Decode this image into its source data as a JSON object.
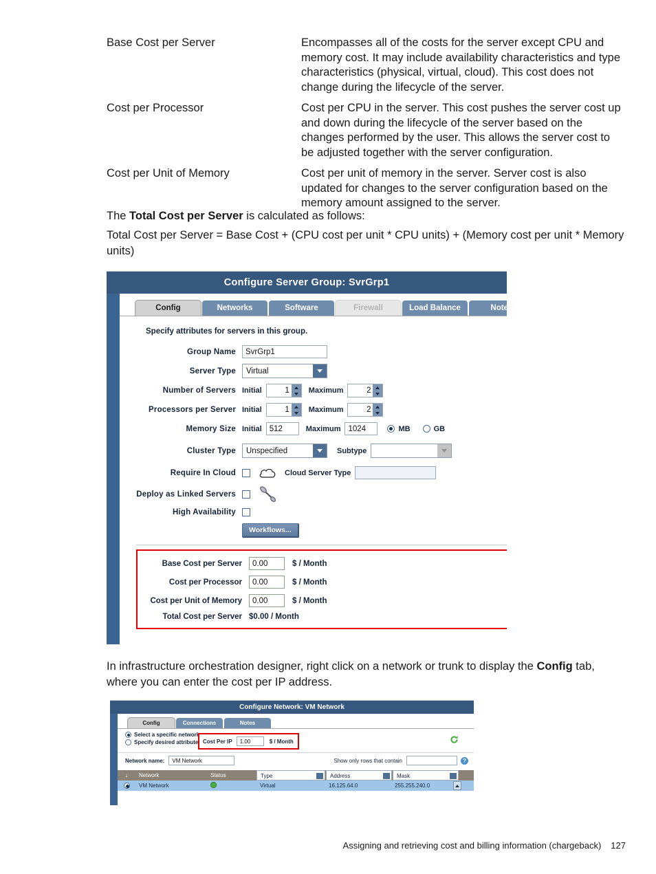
{
  "definitions": [
    {
      "term": "Base Cost per Server",
      "description": "Encompasses all of the costs for the server except CPU and memory cost. It may include availability characteristics and type characteristics (physical, virtual, cloud). This cost does not change during the lifecycle of the server."
    },
    {
      "term": "Cost per Processor",
      "description": "Cost per CPU in the server. This cost pushes the server cost up and down during the lifecycle of the server based on the changes performed by the user. This allows the server cost to be adjusted together with the server configuration."
    },
    {
      "term": "Cost per Unit of Memory",
      "description": "Cost per unit of memory in the server. Server cost is also updated for changes to the server configuration based on the memory amount assigned to the server."
    }
  ],
  "paragraphs": {
    "total_intro_pre": "The ",
    "total_intro_bold": "Total Cost per Server",
    "total_intro_post": " is calculated as follows:",
    "formula": "Total Cost per Server = Base Cost + (CPU cost per unit * CPU units) + (Memory cost per unit * Memory units)",
    "designer_pre": "In infrastructure orchestration designer, right click on a network or trunk to display the ",
    "designer_bold": "Config",
    "designer_post": " tab, where you can enter the cost per IP address."
  },
  "server_dialog": {
    "title": "Configure Server Group: SvrGrp1",
    "tabs": [
      {
        "label": "Config",
        "state": "active"
      },
      {
        "label": "Networks",
        "state": "normal"
      },
      {
        "label": "Software",
        "state": "normal"
      },
      {
        "label": "Firewall",
        "state": "disabled"
      },
      {
        "label": "Load Balance",
        "state": "normal"
      },
      {
        "label": "Notes",
        "state": "normal"
      }
    ],
    "hint": "Specify attributes for servers in this group.",
    "group_name": {
      "label": "Group Name",
      "value": "SvrGrp1"
    },
    "server_type": {
      "label": "Server Type",
      "value": "Virtual"
    },
    "number_of_servers": {
      "label": "Number of Servers",
      "initial_label": "Initial",
      "initial": "1",
      "maximum_label": "Maximum",
      "maximum": "2"
    },
    "processors_per_server": {
      "label": "Processors per Server",
      "initial_label": "Initial",
      "initial": "1",
      "maximum_label": "Maximum",
      "maximum": "2"
    },
    "memory_size": {
      "label": "Memory Size",
      "initial_label": "Initial",
      "initial": "512",
      "maximum_label": "Maximum",
      "maximum": "1024",
      "unit_mb": "MB",
      "unit_gb": "GB",
      "unit_selected": "MB"
    },
    "cluster_type": {
      "label": "Cluster Type",
      "value": "Unspecified",
      "subtype_label": "Subtype",
      "subtype_value": ""
    },
    "require_in_cloud": {
      "label": "Require In Cloud",
      "checked": false,
      "cloud_server_type_label": "Cloud Server Type",
      "cloud_server_type_value": ""
    },
    "deploy_as_linked_servers": {
      "label": "Deploy as Linked Servers",
      "checked": false
    },
    "high_availability": {
      "label": "High Availability",
      "checked": false
    },
    "workflows_button": "Workflows...",
    "cost_panel": {
      "highlight_color": "#e00000",
      "rows": [
        {
          "label": "Base Cost per Server",
          "value": "0.00",
          "unit": "$ / Month"
        },
        {
          "label": "Cost per Processor",
          "value": "0.00",
          "unit": "$ / Month"
        },
        {
          "label": "Cost per Unit of Memory",
          "value": "0.00",
          "unit": "$ / Month"
        }
      ],
      "total_label": "Total Cost per Server",
      "total_value": "$0.00 / Month"
    }
  },
  "network_dialog": {
    "title": "Configure Network: VM Network",
    "tabs": [
      {
        "label": "Config",
        "state": "active"
      },
      {
        "label": "Connections",
        "state": "normal"
      },
      {
        "label": "Notes",
        "state": "normal"
      }
    ],
    "radio_specific": "Select a specific network",
    "radio_attributes": "Specify desired attributes",
    "cost_per_ip": {
      "label": "Cost Per IP",
      "value": "1.00",
      "unit": "$ / Month"
    },
    "network_name": {
      "label": "Network name:",
      "value": "VM Network"
    },
    "filter": {
      "label": "Show only rows that contain",
      "value": ""
    },
    "table": {
      "columns": [
        "Network",
        "Status",
        "Type",
        "Address",
        "Mask"
      ],
      "rows": [
        {
          "network": "VM Network",
          "status": "ok",
          "type": "Virtual",
          "address": "16.125.64.0",
          "mask": "255.255.240.0",
          "selected": true
        }
      ]
    },
    "help_icon": "?"
  },
  "footer": {
    "text": "Assigning and retrieving cost and billing information (chargeback)",
    "page": "127"
  }
}
